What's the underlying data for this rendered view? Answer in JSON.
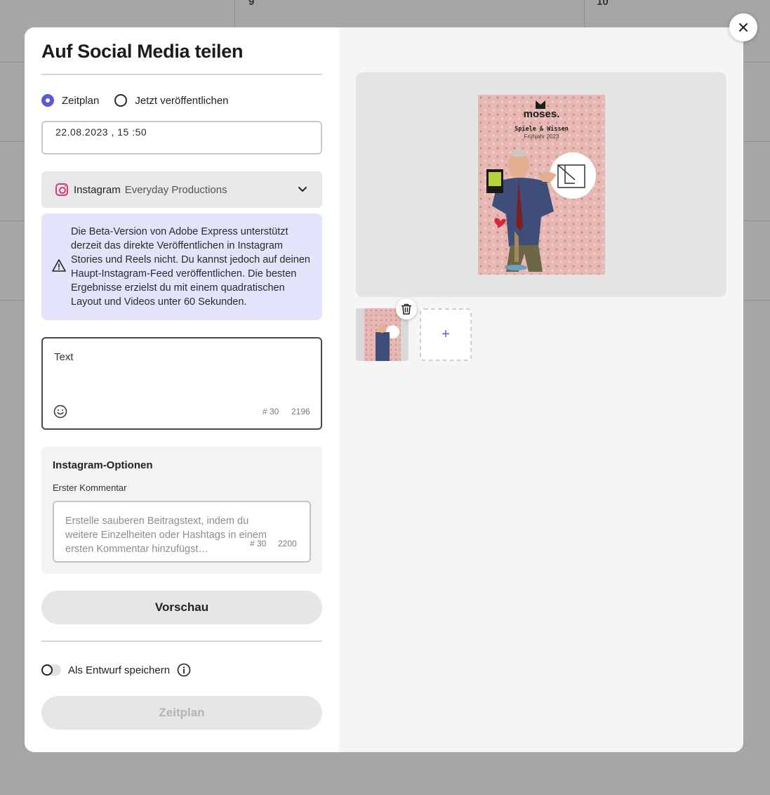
{
  "background_calendar": {
    "day_numbers": [
      "9",
      "10"
    ]
  },
  "dialog": {
    "title": "Auf Social Media teilen",
    "publish_mode": {
      "options": [
        "Zeitplan",
        "Jetzt veröffentlichen"
      ],
      "selected": "Zeitplan"
    },
    "datetime_value": "22.08.2023 , 15 :50",
    "account_selector": {
      "service": "Instagram",
      "account": "Everyday Productions",
      "icon": "instagram-icon"
    },
    "beta_notice": "Die Beta-Version von Adobe Express unterstützt derzeit das direkte Veröffentlichen in Instagram Stories und Reels nicht. Du kannst jedoch auf deinen Haupt-Instagram-Feed veröffentlichen. Die besten Ergebnisse erzielst du mit einem quadratischen Layout und Videos unter 60 Sekunden.",
    "caption": {
      "placeholder": "Text",
      "hashtag_counter": "# 30",
      "char_counter": "2196"
    },
    "instagram_options": {
      "title": "Instagram-Optionen",
      "first_comment_label": "Erster Kommentar",
      "first_comment_placeholder": "Erstelle sauberen Beitragstext, indem du weitere Einzelheiten oder Hashtags in einem ersten Kommentar hinzufügst…",
      "hashtag_counter": "# 30",
      "char_counter": "2200"
    },
    "preview_button": "Vorschau",
    "draft_toggle": {
      "label": "Als Entwurf speichern",
      "on": false
    },
    "schedule_button": "Zeitplan",
    "add_media_label": "+"
  },
  "poster": {
    "brand": "moses.",
    "subtitle": "Spiele & Wissen",
    "season": "Frühjahr 2023"
  },
  "colors": {
    "accent": "#5b5bd6",
    "notice_bg": "#e3e3fb",
    "instagram": "#d63a7a"
  }
}
